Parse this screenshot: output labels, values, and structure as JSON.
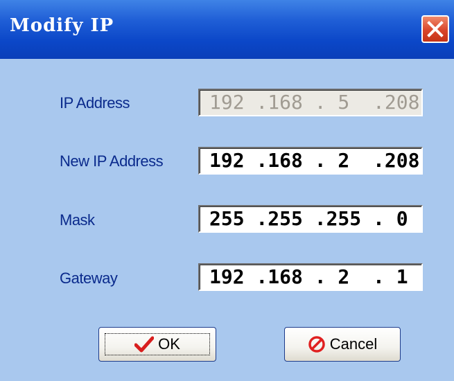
{
  "window": {
    "title": "Modify IP",
    "close_icon": "close-icon"
  },
  "fields": [
    {
      "label": "IP Address",
      "value": "192 .168 . 5  .208",
      "enabled": false
    },
    {
      "label": "New IP Address",
      "value": "192 .168 . 2  .208",
      "enabled": true
    },
    {
      "label": "Mask",
      "value": "255 .255 .255 . 0",
      "enabled": true
    },
    {
      "label": "Gateway",
      "value": "192 .168 . 2  . 1",
      "enabled": true
    }
  ],
  "buttons": {
    "ok_label": "OK",
    "ok_icon": "checkmark-icon",
    "cancel_label": "Cancel",
    "cancel_icon": "prohibited-icon"
  },
  "colors": {
    "dialog_bg": "#a9c8ee",
    "titlebar": "#0b47c8",
    "label_text": "#0a2a8c",
    "ok_check": "#d81e1e",
    "cancel_icon": "#e02020"
  }
}
